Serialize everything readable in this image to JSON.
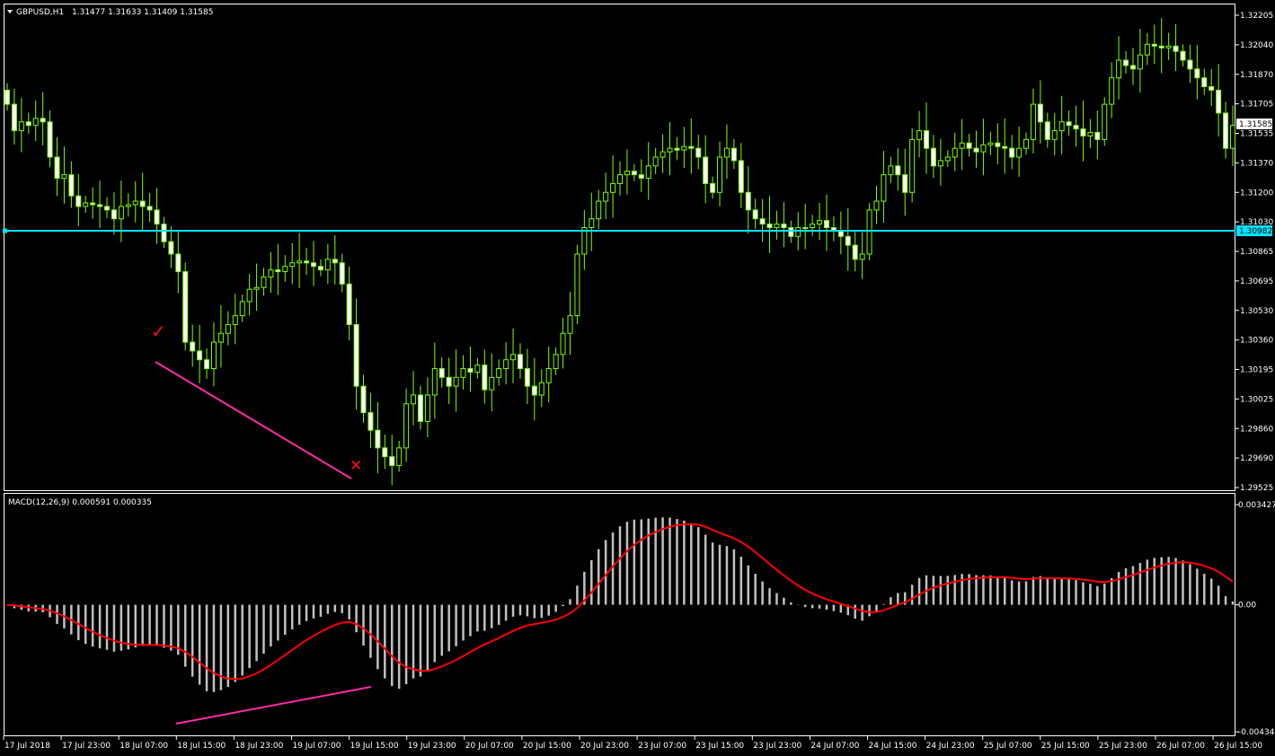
{
  "main_header": {
    "symbol_label": "GBPUSD,H1",
    "ohlc": "1.31477 1.31633 1.31409 1.31585"
  },
  "macd_header": {
    "label": "MACD(12,26,9) 0.000591 0.000335"
  },
  "price_axis": {
    "ticks": [
      "1.32205",
      "1.32040",
      "1.31870",
      "1.31705",
      "1.31535",
      "1.31370",
      "1.31200",
      "1.31030",
      "1.30865",
      "1.30695",
      "1.30530",
      "1.30360",
      "1.30195",
      "1.30025",
      "1.29860",
      "1.29690",
      "1.29525"
    ],
    "current_price": "1.31585",
    "hline_price": "1.30982"
  },
  "macd_axis": {
    "ticks": [
      "0.003427",
      "0.00",
      "-0.004345"
    ]
  },
  "time_axis": {
    "labels": [
      "17 Jul 2018",
      "17 Jul 23:00",
      "18 Jul 07:00",
      "18 Jul 15:00",
      "18 Jul 23:00",
      "19 Jul 07:00",
      "19 Jul 15:00",
      "19 Jul 23:00",
      "20 Jul 07:00",
      "20 Jul 15:00",
      "20 Jul 23:00",
      "23 Jul 07:00",
      "23 Jul 15:00",
      "23 Jul 23:00",
      "24 Jul 07:00",
      "24 Jul 15:00",
      "24 Jul 23:00",
      "25 Jul 07:00",
      "25 Jul 15:00",
      "25 Jul 23:00",
      "26 Jul 07:00",
      "26 Jul 15:00"
    ]
  },
  "colors": {
    "candle": "#7cfc00",
    "hline": "#00e5ff",
    "macd_hist": "#c0c0c0",
    "signal": "#ff0000",
    "divergence": "#ff2aa8",
    "marker": "#ff1010"
  },
  "annotations": {
    "check_mark": "✓",
    "cross_mark": "✕"
  },
  "chart_data": {
    "type": "candlestick",
    "symbol": "GBPUSD",
    "timeframe": "H1",
    "price_ylim": [
      1.29525,
      1.32205
    ],
    "closes": [
      1.317,
      1.3155,
      1.316,
      1.3158,
      1.3162,
      1.316,
      1.314,
      1.3128,
      1.313,
      1.3118,
      1.3112,
      1.3114,
      1.3113,
      1.3112,
      1.311,
      1.3105,
      1.3112,
      1.3113,
      1.3115,
      1.3112,
      1.311,
      1.3102,
      1.3092,
      1.3085,
      1.3075,
      1.3035,
      1.303,
      1.3025,
      1.302,
      1.3035,
      1.304,
      1.3045,
      1.305,
      1.3058,
      1.3065,
      1.3066,
      1.3072,
      1.3076,
      1.3075,
      1.3078,
      1.308,
      1.3081,
      1.308,
      1.3078,
      1.3076,
      1.3082,
      1.308,
      1.3068,
      1.3045,
      1.301,
      1.2995,
      1.2985,
      1.2975,
      1.297,
      1.2965,
      1.2975,
      1.3,
      1.3005,
      1.299,
      1.3005,
      1.302,
      1.3015,
      1.301,
      1.3015,
      1.302,
      1.3018,
      1.3022,
      1.3008,
      1.3015,
      1.302,
      1.3025,
      1.3028,
      1.302,
      1.301,
      1.3005,
      1.3012,
      1.302,
      1.3028,
      1.304,
      1.305,
      1.3085,
      1.31,
      1.3105,
      1.3115,
      1.312,
      1.3125,
      1.313,
      1.3132,
      1.313,
      1.3128,
      1.3135,
      1.314,
      1.3143,
      1.3145,
      1.3144,
      1.3146,
      1.3145,
      1.314,
      1.3125,
      1.312,
      1.314,
      1.3145,
      1.3138,
      1.312,
      1.311,
      1.3105,
      1.3102,
      1.31,
      1.3102,
      1.31,
      1.3095,
      1.31,
      1.31,
      1.3102,
      1.3104,
      1.31,
      1.3098,
      1.3095,
      1.309,
      1.3082,
      1.3085,
      1.311,
      1.3115,
      1.313,
      1.3135,
      1.313,
      1.312,
      1.315,
      1.3155,
      1.3145,
      1.3135,
      1.3138,
      1.314,
      1.3145,
      1.3148,
      1.3145,
      1.3143,
      1.3147,
      1.3148,
      1.3146,
      1.3145,
      1.314,
      1.3145,
      1.315,
      1.317,
      1.316,
      1.315,
      1.3155,
      1.316,
      1.3158,
      1.3156,
      1.3152,
      1.3154,
      1.315,
      1.317,
      1.3185,
      1.3195,
      1.3192,
      1.319,
      1.3198,
      1.3204,
      1.3203,
      1.3202,
      1.3203,
      1.32,
      1.3195,
      1.319,
      1.3185,
      1.318,
      1.3178,
      1.3165,
      1.3145,
      1.3158
    ]
  }
}
